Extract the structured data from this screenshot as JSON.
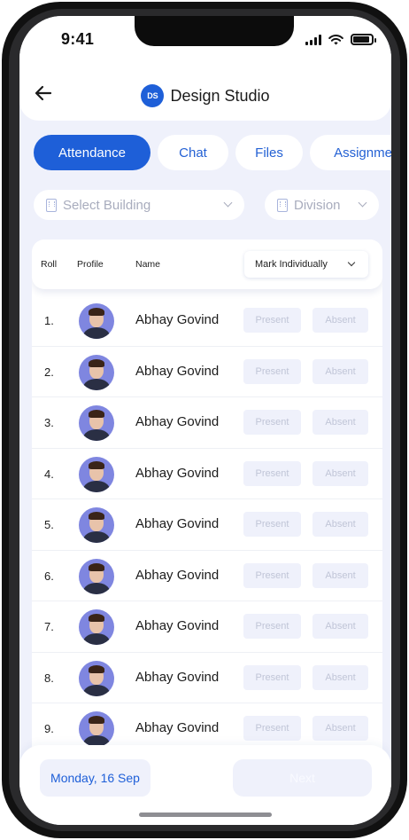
{
  "status": {
    "time": "9:41"
  },
  "header": {
    "badge": "DS",
    "title": "Design Studio"
  },
  "tabs": [
    {
      "label": "Attendance",
      "active": true
    },
    {
      "label": "Chat",
      "active": false
    },
    {
      "label": "Files",
      "active": false
    },
    {
      "label": "Assignme",
      "active": false
    }
  ],
  "filters": {
    "building": {
      "label": "Select Building"
    },
    "division": {
      "label": "Division"
    }
  },
  "table": {
    "headers": {
      "roll": "Roll",
      "profile": "Profile",
      "name": "Name",
      "mark": "Mark Individually"
    },
    "rows": [
      {
        "roll": "1.",
        "name": "Abhay Govind",
        "present": "Present",
        "absent": "Absent"
      },
      {
        "roll": "2.",
        "name": "Abhay Govind",
        "present": "Present",
        "absent": "Absent"
      },
      {
        "roll": "3.",
        "name": "Abhay Govind",
        "present": "Present",
        "absent": "Absent"
      },
      {
        "roll": "4.",
        "name": "Abhay Govind",
        "present": "Present",
        "absent": "Absent"
      },
      {
        "roll": "5.",
        "name": "Abhay Govind",
        "present": "Present",
        "absent": "Absent"
      },
      {
        "roll": "6.",
        "name": "Abhay Govind",
        "present": "Present",
        "absent": "Absent"
      },
      {
        "roll": "7.",
        "name": "Abhay Govind",
        "present": "Present",
        "absent": "Absent"
      },
      {
        "roll": "8.",
        "name": "Abhay Govind",
        "present": "Present",
        "absent": "Absent"
      },
      {
        "roll": "9.",
        "name": "Abhay Govind",
        "present": "Present",
        "absent": "Absent"
      }
    ]
  },
  "footer": {
    "date": "Monday, 16 Sep",
    "next": "Next"
  },
  "colors": {
    "accent": "#1e5fd8",
    "background": "#eff1fb",
    "muted": "#c0c5d7"
  },
  "icons": {
    "back": "arrow-left-icon",
    "building": "building-icon",
    "dropdown": "chevron-down-icon"
  }
}
